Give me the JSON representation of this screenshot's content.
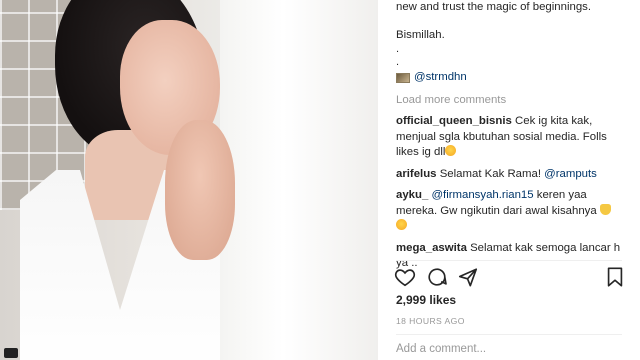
{
  "post": {
    "caption_lines": [
      "new and trust the magic of beginnings.",
      "",
      "Bismillah.",
      ".",
      "."
    ],
    "tag_mention": "@strmdhn"
  },
  "load_more_label": "Load more comments",
  "comments": [
    {
      "user": "official_queen_bisnis",
      "text": " Cek ig kita kak, menjual sgla kbutuhan sosial media. Folls likes ig dll",
      "emoji": "smile"
    },
    {
      "user": "arifelus",
      "text": " Selamat Kak Rama! ",
      "mention": "@ramputs"
    },
    {
      "user": "ayku_",
      "mention": " @firmansyah.rian15",
      "text": " keren yaa mereka. Gw ngikutin dari awal kisahnya ",
      "emoji": "heart",
      "emoji2": "smile"
    },
    {
      "user": "mega_aswita",
      "text": " Selamat kak semoga lancar h ya .."
    }
  ],
  "actions": {
    "like_icon": "heart-icon",
    "comment_icon": "comment-icon",
    "share_icon": "share-icon",
    "save_icon": "bookmark-icon"
  },
  "likes_label": "2,999 likes",
  "timestamp": "18 HOURS AGO",
  "add_comment_placeholder": "Add a comment..."
}
